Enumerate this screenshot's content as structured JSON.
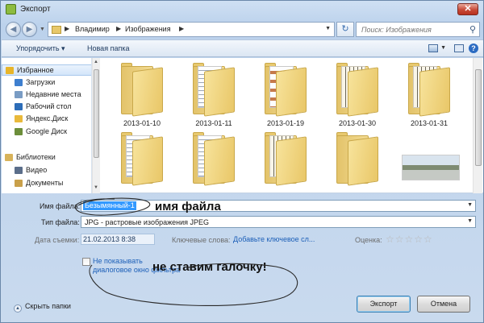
{
  "window": {
    "title": "Экспорт",
    "close_label": "✕"
  },
  "address": {
    "crumbs": [
      "Владимир",
      "Изображения"
    ],
    "search_placeholder": "Поиск: Изображения"
  },
  "toolbar": {
    "organize_label": "Упорядочить ▾",
    "new_folder_label": "Новая папка"
  },
  "nav": {
    "items": [
      {
        "label": "Избранное",
        "icon": "star-icon",
        "color": "#e8b52a"
      },
      {
        "label": "Загрузки",
        "icon": "downloads-folder-icon",
        "color": "#3e7fcf"
      },
      {
        "label": "Недавние места",
        "icon": "recent-places-icon",
        "color": "#7a9cc4"
      },
      {
        "label": "Рабочий стол",
        "icon": "desktop-icon",
        "color": "#2d6db8"
      },
      {
        "label": "Яндекс.Диск",
        "icon": "yandex-disk-icon",
        "color": "#e9b93b"
      },
      {
        "label": "Google Диск",
        "icon": "google-drive-icon",
        "color": "#6c8e3a"
      },
      {
        "label": "Библиотеки",
        "icon": "libraries-icon",
        "color": "#d8b35a"
      },
      {
        "label": "Видео",
        "icon": "video-icon",
        "color": "#5b6e8a"
      },
      {
        "label": "Документы",
        "icon": "documents-icon",
        "color": "#c9a04a"
      }
    ]
  },
  "files": [
    {
      "name": "2013-01-10",
      "preview": "blank"
    },
    {
      "name": "2013-01-11",
      "preview": "lines"
    },
    {
      "name": "2013-01-19",
      "preview": "photo"
    },
    {
      "name": "2013-01-30",
      "preview": "grid"
    },
    {
      "name": "2013-01-31",
      "preview": "grid"
    },
    {
      "name": "",
      "preview": "doc-card"
    },
    {
      "name": "",
      "preview": "lines"
    },
    {
      "name": "",
      "preview": "grid"
    },
    {
      "name": "",
      "preview": "blank"
    },
    {
      "name": "",
      "preview": "photo-thumb"
    }
  ],
  "form": {
    "filename_label": "Имя файла:",
    "filename_value": "Безымянный-1",
    "filetype_label": "Тип файла:",
    "filetype_value": "JPG - растровые изображения JPEG",
    "date_label": "Дата съемки:",
    "date_value": "21.02.2013 8:38",
    "keywords_label": "Ключевые слова:",
    "keywords_link": "Добавьте ключевое сл...",
    "rating_label": "Оценка:",
    "rating_value": 0,
    "rating_stars": "☆☆☆☆☆",
    "checkbox_label": "Не показывать диалоговое окно фильтра",
    "checkbox_checked": false,
    "annotation_filename": "имя файла",
    "annotation_checkbox": "не ставим галочку!",
    "hide_folders_label": "Скрыть папки",
    "export_button": "Экспорт",
    "cancel_button": "Отмена"
  }
}
